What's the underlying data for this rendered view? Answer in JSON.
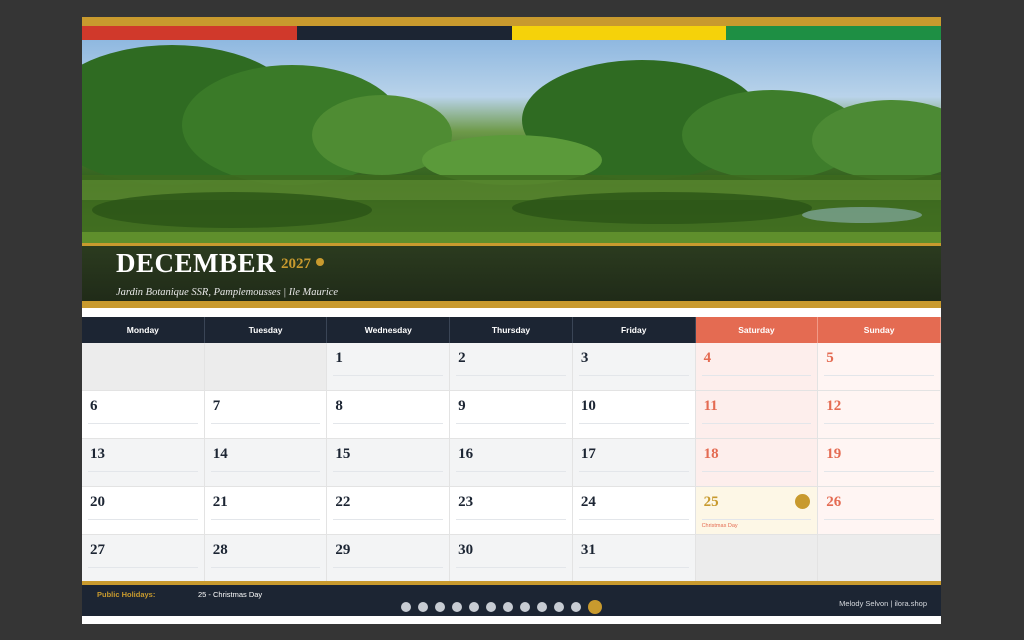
{
  "flag_colors": [
    "#d0392b",
    "#1c2533",
    "#f5d20a",
    "#1e8f44"
  ],
  "accent_color": "#c89a2e",
  "weekend_color": "#e46b52",
  "header": {
    "month": "DECEMBER",
    "year": "2027",
    "location": "Jardin Botanique SSR, Pamplemousses  |  Ile Maurice"
  },
  "weekdays": [
    "Monday",
    "Tuesday",
    "Wednesday",
    "Thursday",
    "Friday",
    "Saturday",
    "Sunday"
  ],
  "weeks": [
    [
      "",
      "",
      "1",
      "2",
      "3",
      "4",
      "5"
    ],
    [
      "6",
      "7",
      "8",
      "9",
      "10",
      "11",
      "12"
    ],
    [
      "13",
      "14",
      "15",
      "16",
      "17",
      "18",
      "19"
    ],
    [
      "20",
      "21",
      "22",
      "23",
      "24",
      "25",
      "26"
    ],
    [
      "27",
      "28",
      "29",
      "30",
      "31",
      "",
      ""
    ]
  ],
  "holiday": {
    "day": "25",
    "name": "Christmas Day"
  },
  "footer": {
    "holidays_label": "Public Holidays:",
    "holidays_value": "25 - Christmas Day",
    "credit": "Melody Selvon  |  ilora.shop"
  },
  "pagination": {
    "total": 12,
    "active": 12
  }
}
